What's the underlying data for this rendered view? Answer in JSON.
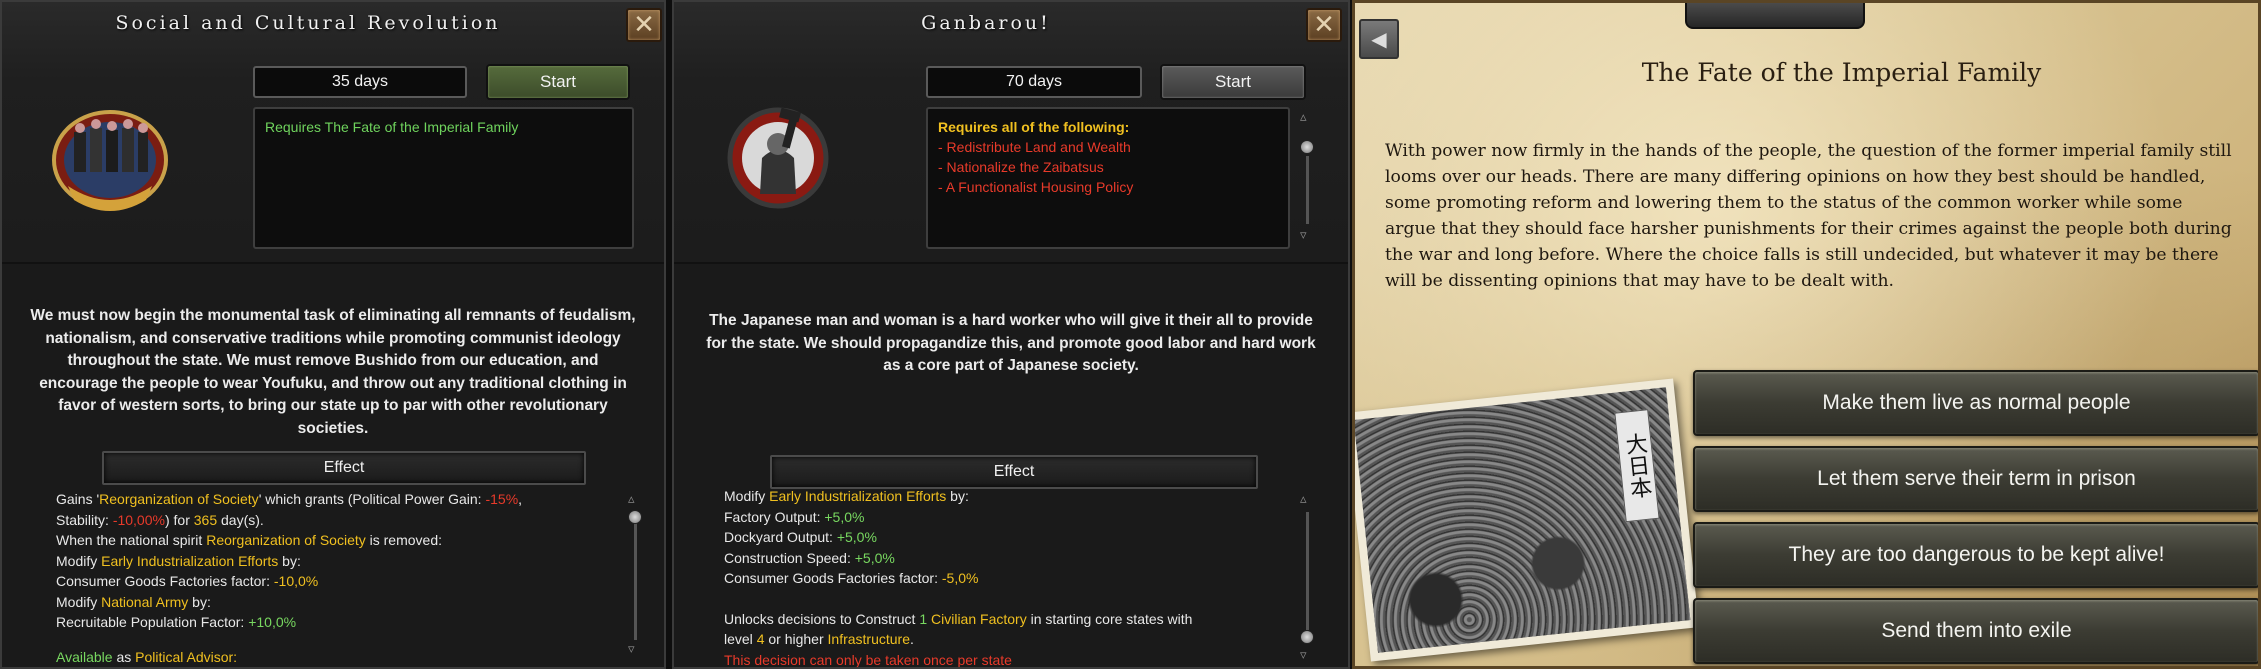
{
  "panel1": {
    "title": "Social and Cultural Revolution",
    "days": "35 days",
    "start_label": "Start",
    "requirement": "Requires The Fate of the Imperial Family",
    "description": "We must now begin the monumental task of eliminating all remnants of feudalism, nationalism, and conservative traditions while promoting communist ideology throughout the state. We must remove Bushido from our education, and encourage the people to wear Youfuku, and throw out any traditional clothing in favor of western sorts, to bring our state up to par with other revolutionary societies.",
    "effect_label": "Effect",
    "effects": {
      "l1a": "Gains '",
      "l1b": "Reorganization of Society",
      "l1c": "' which grants (Political Power Gain: ",
      "l1d": "-15%",
      "l1e": ",",
      "l2a": "Stability: ",
      "l2b": "-10,00%",
      "l2c": ") for ",
      "l2d": "365",
      "l2e": " day(s).",
      "l3a": "When the national spirit ",
      "l3b": "Reorganization of Society",
      "l3c": " is removed:",
      "l4a": "Modify ",
      "l4b": "Early Industrialization Efforts",
      "l4c": " by:",
      "l5a": " Consumer Goods Factories factor: ",
      "l5b": "-10,0%",
      "l6a": "Modify ",
      "l6b": "National Army",
      "l6c": " by:",
      "l7a": " Recruitable Population Factor: ",
      "l7b": "+10,0%",
      "l8a": "Available",
      "l8b": " as ",
      "l8c": "Political Advisor:"
    }
  },
  "panel2": {
    "title": "Ganbarou!",
    "days": "70 days",
    "start_label": "Start",
    "req_header": "Requires all of the following:",
    "req_items": [
      "- Redistribute Land and Wealth",
      "- Nationalize the Zaibatsus",
      "- A Functionalist Housing Policy"
    ],
    "description": "The Japanese man and woman is a hard worker who will give it their all to provide for the state. We should propagandize this, and promote good labor and hard work as a core part of Japanese society.",
    "effect_label": "Effect",
    "effects": {
      "l1a": "Modify ",
      "l1b": "Early Industrialization Efforts",
      "l1c": " by:",
      "l2a": " Factory Output: ",
      "l2b": "+5,0%",
      "l3a": " Dockyard Output: ",
      "l3b": "+5,0%",
      "l4a": " Construction Speed: ",
      "l4b": "+5,0%",
      "l5a": " Consumer Goods Factories factor: ",
      "l5b": "-5,0%",
      "l6a": "Unlocks decisions to Construct ",
      "l6b": "1",
      "l6c": " ",
      "l6d": "Civilian Factory",
      "l6e": " in starting core states with",
      "l7a": "level ",
      "l7b": "4",
      "l7c": " or higher ",
      "l7d": "Infrastructure",
      "l7e": ".",
      "l8": "This decision can only be taken once per state"
    }
  },
  "event": {
    "title": "The Fate of the Imperial Family",
    "text": "With power now firmly in the hands of the people, the question of the former imperial family still looms over our heads. There are many differing opinions on how they best should be handled, some promoting reform and lowering them to the status of the common worker while some argue that they should face harsher punishments for their crimes against the people both during the war and long before. Where the choice falls is still undecided, but whatever it may be there will be dissenting opinions that may have to be dealt with.",
    "photo_banner": "大日本",
    "options": [
      "Make them live as normal people",
      "Let them serve their term in prison",
      "They are too dangerous to be kept alive!",
      "Send them into exile"
    ]
  },
  "colors": {
    "highlight_yellow": "#f0c020",
    "negative_red": "#e83a2a",
    "positive_green": "#78d860",
    "start_green": "#566b3c"
  }
}
